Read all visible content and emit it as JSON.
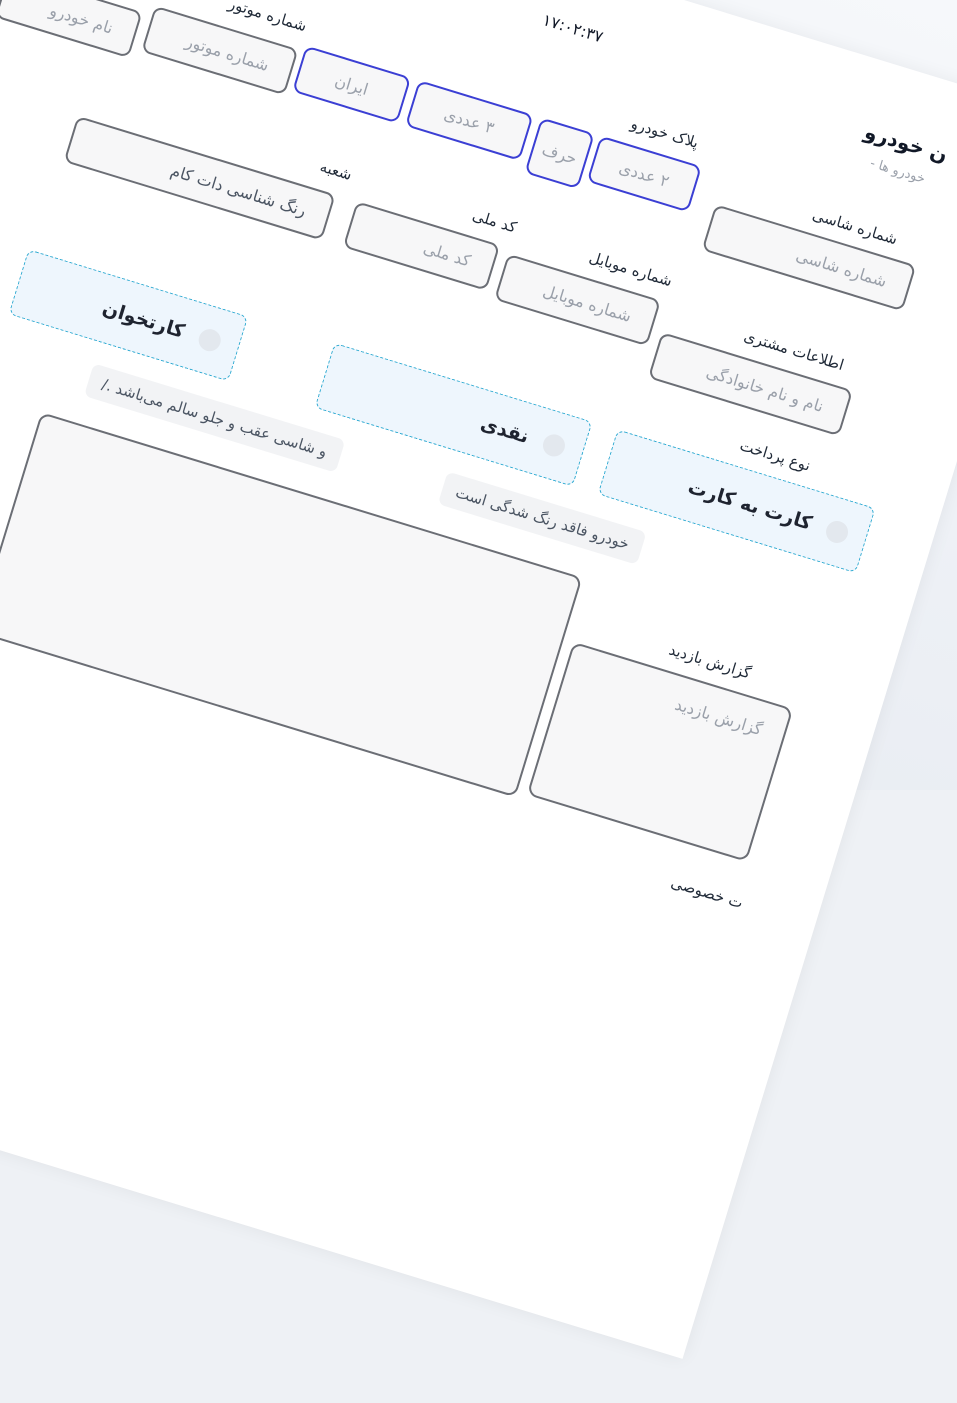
{
  "header": {
    "time": "۱۷:۰۲:۳۷",
    "title": "ن خودرو",
    "breadcrumb": "خودرو ها -"
  },
  "form": {
    "owner_name": {
      "placeholder": "نام خودرو"
    },
    "engine_number": {
      "label": "شماره موتور",
      "placeholder": "شماره موتور"
    },
    "plate": {
      "label": "پلاک خودرو",
      "iran": "ایران",
      "three_digits": "۳ عددی",
      "letter": "حرف",
      "two_digits": "۲ عددی"
    },
    "chassis": {
      "label": "شماره شاسی",
      "placeholder": "شماره شاسی"
    },
    "branch": {
      "label": "شعبه",
      "value": "رنگ شناسی دات کام"
    },
    "national_code": {
      "label": "کد ملی",
      "placeholder": "کد ملی"
    },
    "mobile": {
      "label": "شماره موبایل",
      "placeholder": "شماره موبایل"
    },
    "customer": {
      "label": "اطلاعات مشتری",
      "placeholder": "نام و نام خانوادگی"
    },
    "payment": {
      "label": "نوع پرداخت",
      "options": [
        "کارت به کارت",
        "نقدی",
        "کارتخوان"
      ]
    },
    "chips": [
      "خودرو فاقد رنگ شدگی است",
      "و شاسی عقب و جلو سالم می‌باشد ./"
    ],
    "report": {
      "label": "گزارش بازدید",
      "placeholder": "گزارش بازدید"
    },
    "special": {
      "label": "ت خصوصی"
    }
  }
}
